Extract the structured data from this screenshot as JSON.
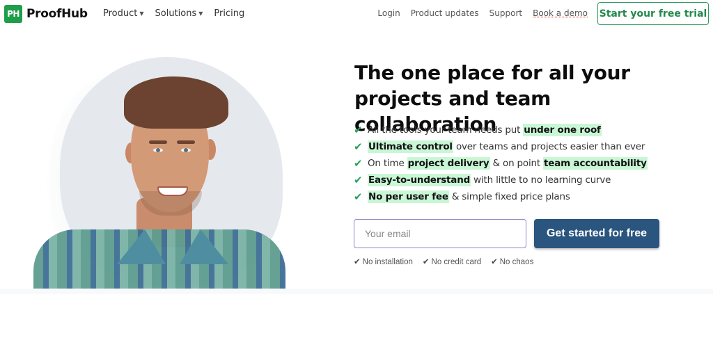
{
  "brand": {
    "logo_mark": "PH",
    "name": "ProofHub",
    "color": "#1f9e4a"
  },
  "nav": {
    "left": [
      {
        "label": "Product",
        "has_dropdown": true
      },
      {
        "label": "Solutions",
        "has_dropdown": true
      },
      {
        "label": "Pricing",
        "has_dropdown": false
      }
    ],
    "right": [
      {
        "label": "Login"
      },
      {
        "label": "Product updates"
      },
      {
        "label": "Support"
      },
      {
        "label": "Book a demo"
      }
    ],
    "trial_button": "Start your free trial",
    "caret": "▼"
  },
  "hero": {
    "headline_line1": "The one place for all your",
    "headline_line2": "projects and team collaboration",
    "image_alt": "Smiling man in plaid shirt",
    "check_icon": "✔",
    "features": [
      [
        {
          "t": "All the tools your team needs put ",
          "h": false
        },
        {
          "t": "under one roof",
          "h": true
        }
      ],
      [
        {
          "t": "Ultimate control",
          "h": true
        },
        {
          "t": " over teams and projects easier than ever",
          "h": false
        }
      ],
      [
        {
          "t": "On time ",
          "h": false
        },
        {
          "t": "project delivery",
          "h": true
        },
        {
          "t": " & on point ",
          "h": false
        },
        {
          "t": "team accountability",
          "h": true
        }
      ],
      [
        {
          "t": "Easy-to-understand",
          "h": true
        },
        {
          "t": " with little to no learning curve",
          "h": false
        }
      ],
      [
        {
          "t": "No per user fee",
          "h": true
        },
        {
          "t": " & simple fixed price plans",
          "h": false
        }
      ]
    ],
    "email_placeholder": "Your email",
    "email_value": "",
    "cta_label": "Get started for free",
    "cta_color": "#2a557f",
    "highlight_color": "#c9f7d6",
    "perks": [
      "No installation",
      "No credit card",
      "No chaos"
    ]
  }
}
